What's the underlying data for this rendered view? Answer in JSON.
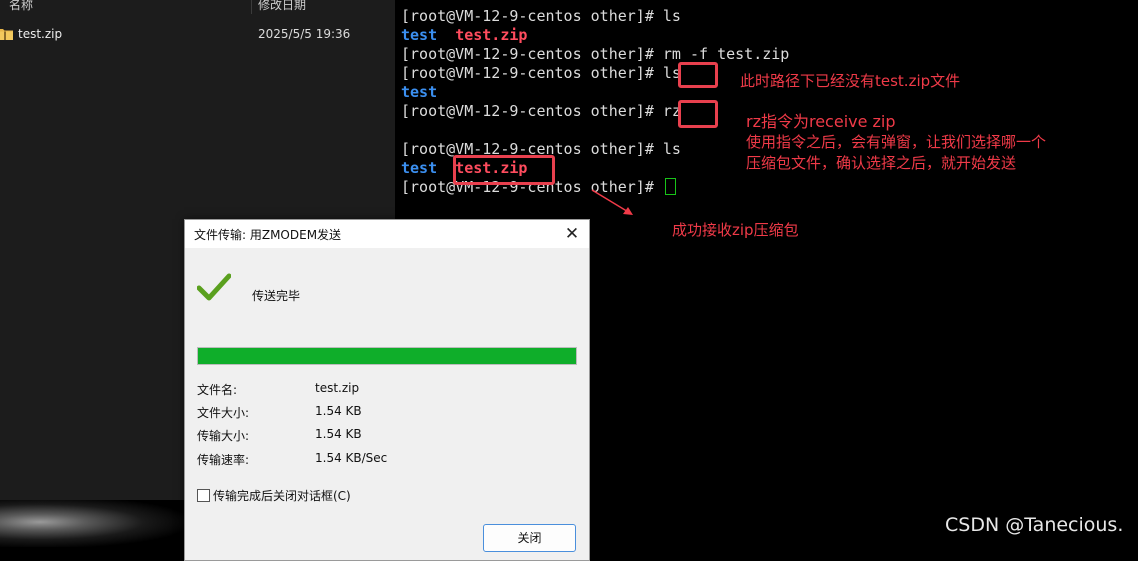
{
  "explorer": {
    "columns": {
      "name": "名称",
      "date": "修改日期"
    },
    "files": [
      {
        "name": "test.zip",
        "date": "2025/5/5 19:36",
        "icon": "zip-folder-icon"
      }
    ]
  },
  "terminal": {
    "lines": [
      {
        "prompt": "[root@VM-12-9-centos other]# ",
        "cmd": "ls"
      },
      {
        "out": [
          {
            "text": "test",
            "style": "blue"
          },
          {
            "text": "  "
          },
          {
            "text": "test.zip",
            "style": "red"
          }
        ]
      },
      {
        "prompt": "[root@VM-12-9-centos other]# ",
        "cmd": "rm -f test.zip"
      },
      {
        "prompt": "[root@VM-12-9-centos other]# ",
        "cmd": "ls"
      },
      {
        "out": [
          {
            "text": "test",
            "style": "blue"
          }
        ]
      },
      {
        "prompt": "[root@VM-12-9-centos other]# ",
        "cmd": "rz"
      },
      {
        "blank": true
      },
      {
        "prompt": "[root@VM-12-9-centos other]# ",
        "cmd": "ls"
      },
      {
        "out": [
          {
            "text": "test",
            "style": "blue"
          },
          {
            "text": "  "
          },
          {
            "text": "test.zip",
            "style": "red"
          }
        ]
      },
      {
        "prompt": "[root@VM-12-9-centos other]# ",
        "cmd": "",
        "cursor": true
      }
    ],
    "colors": {
      "blue": "#3b8ff0",
      "red": "#ff4c5e",
      "cursor": "#19c419",
      "annotation": "#f03a48"
    }
  },
  "annotations": {
    "ls_note": "此时路径下已经没有test.zip文件",
    "rz_title": "rz指令为receive zip",
    "rz_line1": "使用指令之后，会有弹窗，让我们选择哪一个",
    "rz_line2": "压缩包文件，确认选择之后，就开始发送",
    "success_note": "成功接收zip压缩包"
  },
  "dialog": {
    "title": "文件传输: 用ZMODEM发送",
    "close_icon": "close-icon",
    "status": "传送完毕",
    "progress": 1.0,
    "details": [
      {
        "label": "文件名:",
        "value": "test.zip"
      },
      {
        "label": "文件大小:",
        "value": "1.54 KB"
      },
      {
        "label": "传输大小:",
        "value": "1.54 KB"
      },
      {
        "label": "传输速率:",
        "value": "1.54 KB/Sec"
      }
    ],
    "checkbox_label": "传输完成后关闭对话框(C)",
    "checkbox_checked": false,
    "close_button": "关闭"
  },
  "watermark": "CSDN @Tanecious."
}
